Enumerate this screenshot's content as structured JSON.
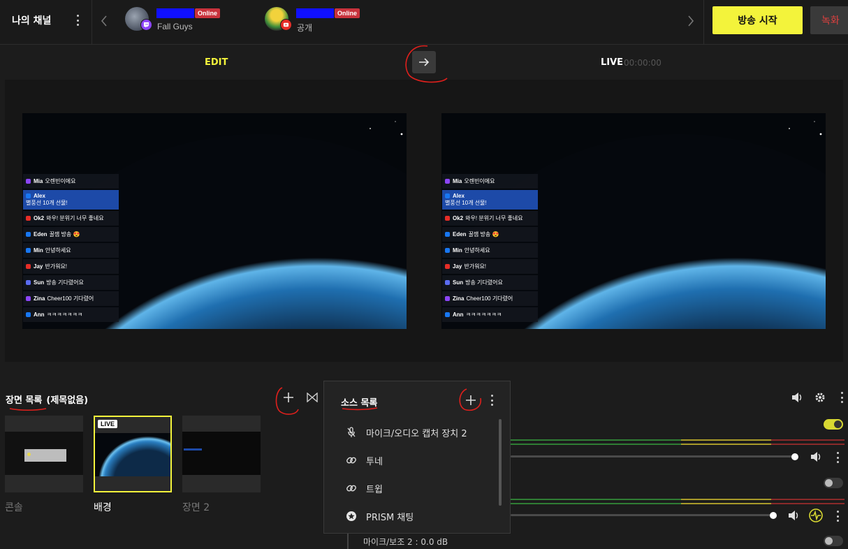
{
  "topbar": {
    "my_channel_label": "나의 채널",
    "channels": [
      {
        "status": "Online",
        "subtitle": "Fall Guys",
        "platform": "twitch"
      },
      {
        "status": "Online",
        "subtitle": "공개",
        "platform": "youtube"
      }
    ],
    "start_button": "방송 시작",
    "record_button": "녹화"
  },
  "modes": {
    "edit_label": "EDIT",
    "live_label": "LIVE",
    "live_time": "00:00:00"
  },
  "chat": [
    {
      "user": "Mia",
      "text": "오렌빈이에요"
    },
    {
      "user": "Alex",
      "text": "별풍선 10개 선물!"
    },
    {
      "user": "Ok2",
      "text": "와우! 분위기 너무 좋네요"
    },
    {
      "user": "Eden",
      "text": "꿀잼 방송 😍"
    },
    {
      "user": "Min",
      "text": "안녕하세요"
    },
    {
      "user": "Jay",
      "text": "반가워요!"
    },
    {
      "user": "Sun",
      "text": "방송 기다렸어요"
    },
    {
      "user": "Zina",
      "text": "Cheer100 기다렸어"
    },
    {
      "user": "Ann",
      "text": "ㅋㅋㅋㅋㅋㅋㅋ"
    }
  ],
  "scenes": {
    "title": "장면 목록",
    "subtitle": "(제목없음)",
    "items": [
      {
        "label": "콘솔"
      },
      {
        "label": "배경",
        "tag": "LIVE"
      },
      {
        "label": "장면 2"
      }
    ]
  },
  "sources": {
    "title": "소스 목록",
    "items": [
      {
        "label": "마이크/오디오 캡처 장치 2",
        "icon": "mic-off-icon"
      },
      {
        "label": "투네",
        "icon": "link-icon"
      },
      {
        "label": "트윕",
        "icon": "link-icon"
      },
      {
        "label": "PRISM 채팅",
        "icon": "prism-chat-icon"
      }
    ]
  },
  "mixer": {
    "bottom_label": "마이크/보조 2 : 0.0 dB",
    "colors": {
      "toggle_on": "#d8d832",
      "meter_green": "#2f7d34",
      "meter_yellow": "#a89a2a",
      "meter_red": "#8a2a2a"
    }
  },
  "colors": {
    "accent": "#f3f33b",
    "online": "#c8323c",
    "record": "#e0403f"
  }
}
